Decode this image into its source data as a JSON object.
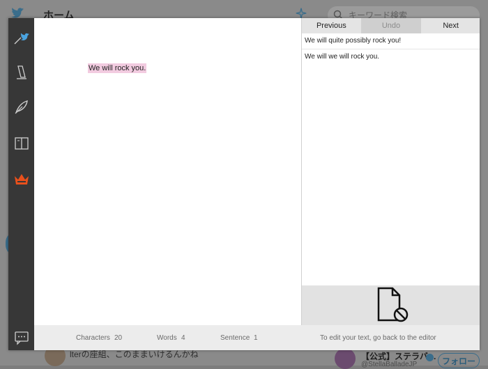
{
  "background": {
    "title": "ホーム",
    "search_placeholder": "キーワード検索",
    "tweet_line": "lterの座組、このままいけるんかね",
    "account_name": "【公式】ステラバ…",
    "account_handle": "@StellaBalladeJP",
    "follow_label": "フォロー"
  },
  "sidebar": {
    "icons": [
      "twitter-pen-icon",
      "pencil-icon",
      "feather-icon",
      "book-icon",
      "crown-icon"
    ],
    "bottom_icon": "comment-icon",
    "accent": "#e8501c"
  },
  "editor": {
    "text": "We will rock you.",
    "highlight_color": "#f2cbe0"
  },
  "suggestions": {
    "previous_label": "Previous",
    "undo_label": "Undo",
    "next_label": "Next",
    "items": [
      "We will quite possibly rock you!",
      "We will we will rock you."
    ],
    "empty_icon": "document-blocked-icon"
  },
  "footer": {
    "characters_label": "Characters",
    "characters_value": "20",
    "words_label": "Words",
    "words_value": "4",
    "sentence_label": "Sentence",
    "sentence_value": "1",
    "hint": "To edit your text, go back to the editor"
  }
}
